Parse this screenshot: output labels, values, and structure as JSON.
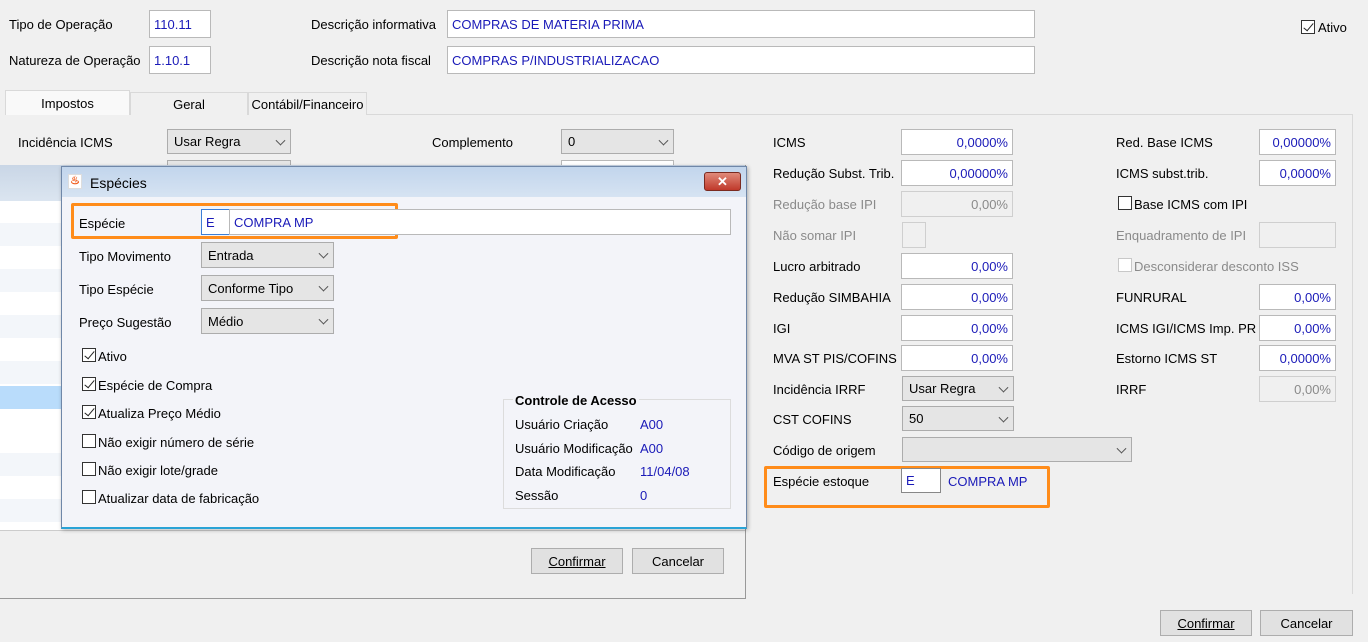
{
  "header": {
    "tipo_operacao": {
      "label": "Tipo de Operação",
      "value": "110.11"
    },
    "natureza_operacao": {
      "label": "Natureza de Operação",
      "value": "1.10.1"
    },
    "descricao_informativa": {
      "label": "Descrição informativa",
      "value": "COMPRAS DE MATERIA PRIMA"
    },
    "descricao_nota": {
      "label": "Descrição nota fiscal",
      "value": "COMPRAS P/INDUSTRIALIZACAO"
    },
    "ativo": {
      "label": "Ativo",
      "checked": true
    }
  },
  "tabs": [
    {
      "label": "Impostos"
    },
    {
      "label": "Geral"
    },
    {
      "label": "Contábil/Financeiro"
    }
  ],
  "impostos": {
    "incidencia_icms": {
      "label": "Incidência ICMS",
      "value": "Usar Regra"
    },
    "complemento": {
      "label": "Complemento",
      "value": "0"
    },
    "left": [
      {
        "label": "ICMS",
        "value": "0,0000%"
      },
      {
        "label": "Redução Subst. Trib.",
        "value": "0,00000%"
      },
      {
        "label": "Redução base IPI",
        "value": "0,00%"
      },
      {
        "label": "Não somar IPI",
        "value": ""
      },
      {
        "label": "Lucro arbitrado",
        "value": "0,00%"
      },
      {
        "label": "Redução SIMBAHIA",
        "value": "0,00%"
      },
      {
        "label": "IGI",
        "value": "0,00%"
      },
      {
        "label": "MVA ST PIS/COFINS",
        "value": "0,00%"
      }
    ],
    "incidencia_irrf": {
      "label": "Incidência IRRF",
      "value": "Usar Regra"
    },
    "cst_cofins": {
      "label": "CST COFINS",
      "value": "50"
    },
    "codigo_origem": {
      "label": "Código de origem",
      "value": ""
    },
    "especie_estoque": {
      "label": "Espécie estoque",
      "code": "E",
      "desc": "COMPRA MP"
    },
    "right": {
      "red_base_icms": {
        "label": "Red. Base ICMS",
        "value": "0,00000%"
      },
      "icms_subst": {
        "label": "ICMS subst.trib.",
        "value": "0,0000%"
      },
      "base_icms_ipi": {
        "label": "Base ICMS com IPI"
      },
      "enquadramento_ipi": {
        "label": "Enquadramento de IPI",
        "value": ""
      },
      "desconsiderar_iss": {
        "label": "Desconsiderar desconto ISS"
      },
      "funrural": {
        "label": "FUNRURAL",
        "value": "0,00%"
      },
      "icms_igi": {
        "label": "ICMS IGI/ICMS Imp. PR",
        "value": "0,00%"
      },
      "estorno_icms_st": {
        "label": "Estorno ICMS ST",
        "value": "0,0000%"
      },
      "irrf": {
        "label": "IRRF",
        "value": "0,00%"
      }
    }
  },
  "footer": {
    "confirm": "Confirmar",
    "cancel": "Cancelar"
  },
  "back_window": {
    "confirm": "Confirmar",
    "cancel": "Cancelar"
  },
  "dialog": {
    "title": "Espécies",
    "especie": {
      "label": "Espécie",
      "code": "E",
      "desc": "COMPRA MP"
    },
    "tipo_movimento": {
      "label": "Tipo Movimento",
      "value": "Entrada"
    },
    "tipo_especie": {
      "label": "Tipo Espécie",
      "value": "Conforme Tipo"
    },
    "preco_sugestao": {
      "label": "Preço Sugestão",
      "value": "Médio"
    },
    "checks": [
      {
        "label": "Ativo",
        "checked": true
      },
      {
        "label": "Espécie de Compra",
        "checked": true
      },
      {
        "label": "Atualiza Preço Médio",
        "checked": true
      },
      {
        "label": "Não exigir número de série",
        "checked": false
      },
      {
        "label": "Não exigir lote/grade",
        "checked": false
      },
      {
        "label": "Atualizar data de fabricação",
        "checked": false
      }
    ],
    "controle": {
      "title": "Controle de Acesso",
      "rows": [
        {
          "label": "Usuário Criação",
          "value": "A00"
        },
        {
          "label": "Usuário Modificação",
          "value": "A00"
        },
        {
          "label": "Data Modificação",
          "value": "11/04/08"
        },
        {
          "label": "Sessão",
          "value": "0"
        }
      ]
    }
  },
  "colors": {
    "accent_orange": "#ff8c1a",
    "value_blue": "#1a1ab8"
  }
}
